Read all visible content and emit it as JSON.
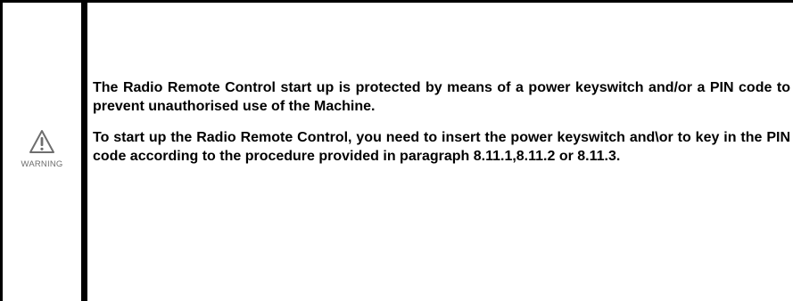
{
  "warning": {
    "icon": "warning-triangle-icon",
    "label": "WARNING",
    "icon_color": "#6e6e6e"
  },
  "paragraphs": [
    "The Radio Remote Control start up is protected by means of a power keyswitch and/or a PIN code to prevent unauthorised use of the Machine.",
    "To start up the Radio Remote Control, you need to insert the power keyswitch and\\or to key in the PIN code according to the procedure provided in paragraph 8.11.1,8.11.2 or 8.11.3."
  ]
}
